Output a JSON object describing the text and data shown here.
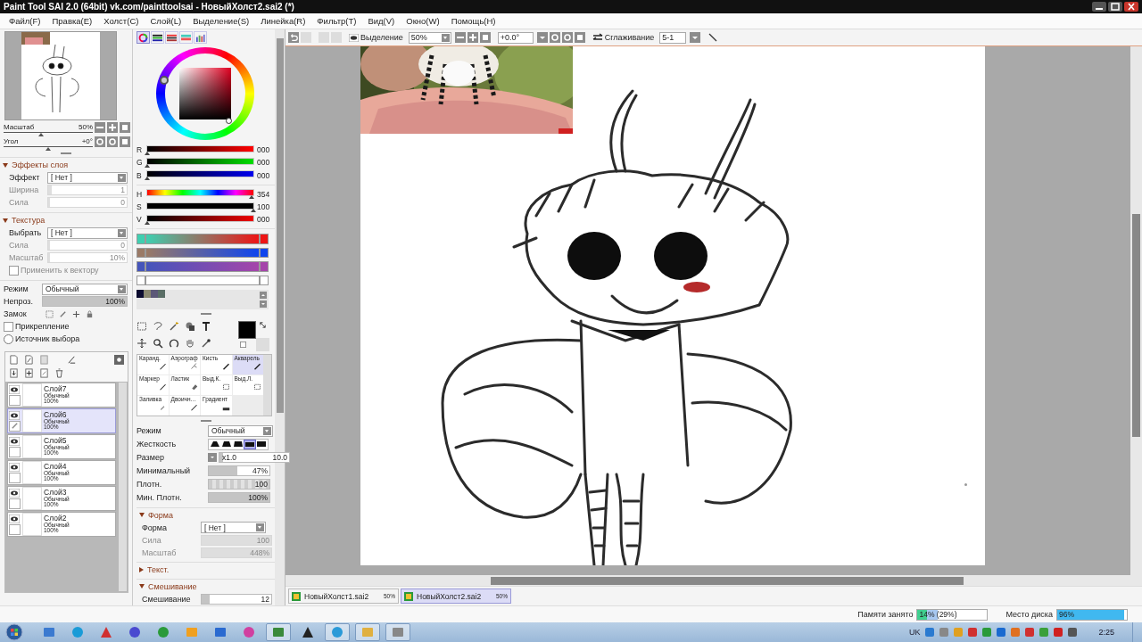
{
  "window": {
    "title": "Paint Tool SAI 2.0 (64bit) vk.com/painttoolsai - НовыйХолст2.sai2 (*)"
  },
  "menu": [
    "Файл(F)",
    "Правка(E)",
    "Холст(C)",
    "Слой(L)",
    "Выделение(S)",
    "Линейка(R)",
    "Фильтр(T)",
    "Вид(V)",
    "Окно(W)",
    "Помощь(H)"
  ],
  "navigator": [
    {
      "label": "Масштаб",
      "value": "50%",
      "level": 0.42
    },
    {
      "label": "Угол",
      "value": "+0°",
      "level": 0.5
    }
  ],
  "panel_sections": [
    {
      "title": "Эффекты слоя",
      "expanded": true,
      "rows": [
        {
          "label": "Эффект",
          "kind": "select",
          "value": "[ Нет ]",
          "disabled": false
        },
        {
          "label": "Ширина",
          "kind": "slider",
          "value": "1",
          "level": 0.05,
          "disabled": true
        },
        {
          "label": "Сила",
          "kind": "slider",
          "value": "0",
          "level": 0,
          "disabled": true
        }
      ]
    },
    {
      "title": "Текстура",
      "expanded": true,
      "rows": [
        {
          "label": "Выбрать",
          "kind": "select",
          "value": "[ Нет ]",
          "disabled": false
        },
        {
          "label": "Сила",
          "kind": "slider",
          "value": "0",
          "level": 0,
          "disabled": true
        },
        {
          "label": "Масштаб",
          "kind": "slider",
          "value": "10%",
          "level": 0,
          "disabled": true
        },
        {
          "label": "Применить к вектору",
          "kind": "checkbox",
          "checked": false,
          "disabled": true
        }
      ]
    }
  ],
  "layer_props": {
    "rows": [
      {
        "label": "Режим",
        "kind": "select",
        "value": "Обычный",
        "disabled": false
      },
      {
        "label": "Непроз.",
        "kind": "slider",
        "value": "100%",
        "level": 1,
        "disabled": false
      }
    ],
    "lock_label": "Замок",
    "options": [
      {
        "label": "Прикрепление",
        "kind": "checkbox",
        "checked": false,
        "disabled": false
      },
      {
        "label": "Источник выбора",
        "kind": "radio",
        "checked": false,
        "disabled": false
      }
    ]
  },
  "layers": [
    {
      "name": "Слой7",
      "mode": "Обычный",
      "opacity": "100%",
      "visible": true,
      "selected": false
    },
    {
      "name": "Слой6",
      "mode": "Обычный",
      "opacity": "100%",
      "visible": true,
      "selected": true
    },
    {
      "name": "Слой5",
      "mode": "Обычный",
      "opacity": "100%",
      "visible": true,
      "selected": false
    },
    {
      "name": "Слой4",
      "mode": "Обычный",
      "opacity": "100%",
      "visible": true,
      "selected": false
    },
    {
      "name": "Слой3",
      "mode": "Обычный",
      "opacity": "100%",
      "visible": true,
      "selected": false
    },
    {
      "name": "Слой2",
      "mode": "Обычный",
      "opacity": "100%",
      "visible": true,
      "selected": false
    }
  ],
  "color_modes": [
    {
      "kind": "wheel",
      "selected": true
    },
    {
      "kind": "rgb",
      "selected": false
    },
    {
      "kind": "hsv",
      "selected": false
    },
    {
      "kind": "mixer",
      "selected": false
    },
    {
      "kind": "palette",
      "selected": false
    }
  ],
  "color_sliders": [
    {
      "label": "R",
      "kind": "red",
      "value": "000",
      "level": 0
    },
    {
      "label": "G",
      "kind": "green",
      "value": "000",
      "level": 0
    },
    {
      "label": "B",
      "kind": "blue",
      "value": "000",
      "level": 0
    },
    {
      "label": "H",
      "kind": "hue",
      "value": "354",
      "level": 0.98
    },
    {
      "label": "S",
      "kind": "saturation",
      "value": "100",
      "level": 1
    },
    {
      "label": "V",
      "kind": "value",
      "value": "000",
      "level": 0
    }
  ],
  "mixers": [
    {
      "ends": [
        {
          "color": "#3fcfb0"
        },
        {
          "color": "#ee1515"
        }
      ]
    },
    {
      "ends": [
        {
          "color": "#9a7a66"
        },
        {
          "color": "#1045ee"
        }
      ]
    },
    {
      "ends": [
        {
          "color": "#4555bb"
        },
        {
          "color": "#a545aa"
        }
      ]
    },
    {
      "ends": [
        {
          "color": "#ffffff"
        },
        {
          "color": "#ffffff"
        }
      ]
    }
  ],
  "swatches": [
    {
      "color": "#0c0c30"
    },
    {
      "color": "#8a8870"
    },
    {
      "color": "#5c5878"
    },
    {
      "color": "#5a6e66"
    }
  ],
  "foreground": {
    "color": "#000000"
  },
  "brushes": [
    {
      "label": "Каранд.",
      "kind": "pencil",
      "selected": false
    },
    {
      "label": "Аэрограф",
      "kind": "airbrush",
      "selected": false
    },
    {
      "label": "Кисть",
      "kind": "brush",
      "selected": false
    },
    {
      "label": "Акварель",
      "kind": "brush",
      "selected": true
    },
    {
      "label": "Маркер",
      "kind": "pencil",
      "selected": false
    },
    {
      "label": "Ластик",
      "kind": "eraser",
      "selected": false
    },
    {
      "label": "Выд.К.",
      "kind": "select",
      "selected": false
    },
    {
      "label": "Выд.Л.",
      "kind": "select",
      "selected": false
    },
    {
      "label": "Заливка",
      "kind": "fill",
      "selected": false
    },
    {
      "label": "Двоичн…",
      "kind": "pencil",
      "selected": false
    },
    {
      "label": "Градиент",
      "kind": "gradient",
      "selected": false
    }
  ],
  "brush_settings": {
    "mode_label": "Режим",
    "mode": "Обычный",
    "hardness_label": "Жесткость",
    "hardness": [
      {
        "selected": false
      },
      {
        "selected": false
      },
      {
        "selected": false
      },
      {
        "selected": true
      },
      {
        "selected": false
      }
    ],
    "rows": [
      {
        "label": "Размер",
        "kind": "size",
        "multiplier": "x1.0",
        "value": "10.0",
        "level": 0.05
      },
      {
        "label": "Минимальный",
        "kind": "slider",
        "value": "47%",
        "level": 0.47
      },
      {
        "label": "Плотн.",
        "kind": "textured",
        "value": "100",
        "level": 1
      },
      {
        "label": "Мин. Плотн.",
        "kind": "slider",
        "value": "100%",
        "level": 1
      }
    ]
  },
  "brush_sections": [
    {
      "title": "Форма",
      "expanded": true,
      "rows": [
        {
          "label": "Форма",
          "kind": "select",
          "value": "[ Нет ]",
          "disabled": false
        },
        {
          "label": "Сила",
          "kind": "slider",
          "value": "100",
          "level": 1,
          "disabled": true
        },
        {
          "label": "Масштаб",
          "kind": "slider",
          "value": "448%",
          "level": 1,
          "disabled": true
        }
      ]
    },
    {
      "title": "Текст.",
      "expanded": false
    },
    {
      "title": "Смешивание",
      "expanded": true,
      "rows": [
        {
          "label": "Смешивание",
          "kind": "slider",
          "value": "12",
          "level": 0.12,
          "disabled": false
        }
      ]
    }
  ],
  "toolbar": {
    "selection_label": "Выделение",
    "zoom": "50%",
    "angle": "+0.0°",
    "smoothing_label": "Сглаживание",
    "smoothing": "5-1"
  },
  "canvas_tabs": [
    {
      "name": "НовыйХолст1.sai2",
      "zoom": "50%",
      "selected": false
    },
    {
      "name": "НовыйХолст2.sai2",
      "zoom": "50%",
      "selected": true
    }
  ],
  "status": {
    "memory": {
      "label": "Памяти занято",
      "value": "14% (29%)",
      "level": 0.14,
      "peak": {
        "level": 0.29
      }
    },
    "disk": {
      "label": "Место диска",
      "value": "96%",
      "level": 0.96
    }
  },
  "taskbar": {
    "language": "UK",
    "clock": "2:25"
  }
}
